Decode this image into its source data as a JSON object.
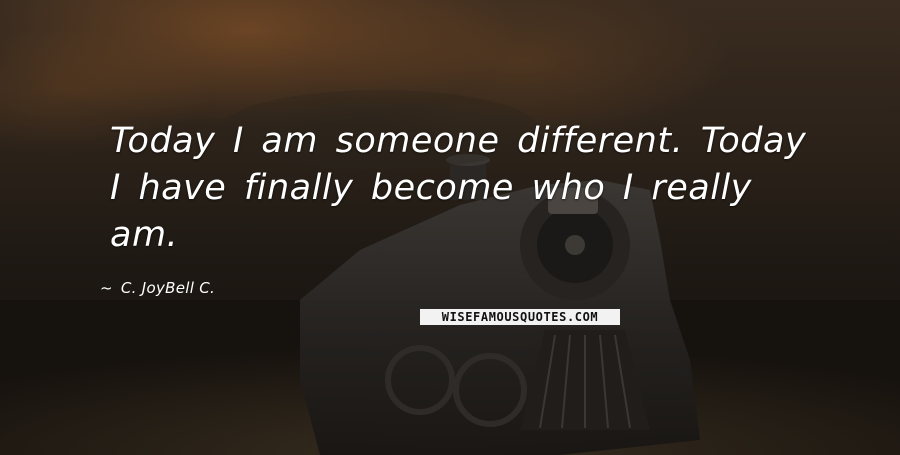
{
  "quote": {
    "text": "Today I am someone different. Today I have finally become who I really am."
  },
  "author": {
    "prefix": "~",
    "name": "C. JoyBell C."
  },
  "watermark": {
    "text": "WISEFAMOUSQUOTES.COM"
  },
  "colors": {
    "text": "#ffffff",
    "watermark_bg": "#f2f2f2"
  }
}
